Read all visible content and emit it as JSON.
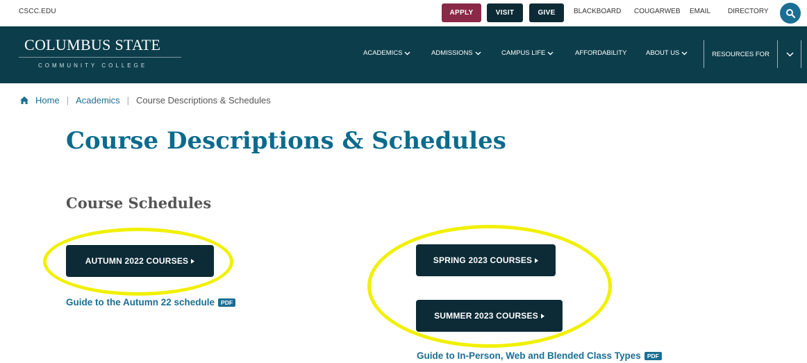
{
  "topbar": {
    "site_link": "CSCC.EDU",
    "apply": "APPLY",
    "visit": "VISIT",
    "give": "GIVE",
    "links": [
      "BLACKBOARD",
      "COUGARWEB",
      "EMAIL",
      "DIRECTORY"
    ],
    "search_icon": "search-icon"
  },
  "logo": {
    "name": "COLUMBUS STATE",
    "subtitle": "COMMUNITY COLLEGE"
  },
  "nav": {
    "items": [
      "ACADEMICS",
      "ADMISSIONS",
      "CAMPUS LIFE",
      "AFFORDABILITY",
      "ABOUT US"
    ],
    "resources": "RESOURCES FOR"
  },
  "breadcrumb": {
    "home": "Home",
    "academics": "Academics",
    "current": "Course Descriptions & Schedules"
  },
  "page": {
    "title": "Course Descriptions & Schedules",
    "section_title": "Course Schedules"
  },
  "buttons": {
    "autumn": "AUTUMN 2022 COURSES",
    "spring": "SPRING 2023 COURSES",
    "summer": "SUMMER 2023 COURSES"
  },
  "guides": {
    "autumn": "Guide to the Autumn 22 schedule",
    "class_types": "Guide to In-Person, Web and Blended Class Types",
    "pdf_badge": "PDF"
  },
  "colors": {
    "navy": "#0c3d4b",
    "button_dark": "#0c2b36",
    "apply_maroon": "#8a2948",
    "link_blue": "#1a6e93",
    "title_blue": "#0c6b8d",
    "highlight_yellow": "#f1f000"
  }
}
